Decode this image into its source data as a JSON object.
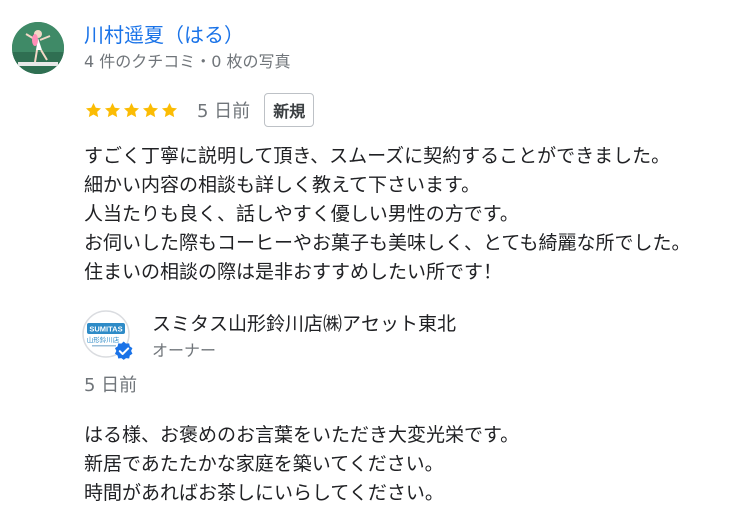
{
  "review": {
    "reviewer_name": "川村遥夏（はる）",
    "reviewer_meta": "4 件のクチコミ・0 枚の写真",
    "rating": 5,
    "rating_max": 5,
    "star_color": "#fbbc04",
    "date": "5 日前",
    "badge": "新規",
    "text_lines": [
      "すごく丁寧に説明して頂き、スムーズに契約することができました。",
      "細かい内容の相談も詳しく教えて下さいます。",
      "人当たりも良く、話しやすく優しい男性の方です。",
      "お伺いした際もコーヒーやお菓子も美味しく、とても綺麗な所でした。",
      "住まいの相談の際は是非おすすめしたい所です！"
    ]
  },
  "owner_reply": {
    "owner_name": "スミタス山形鈴川店㈱アセット東北",
    "role": "オーナー",
    "logo_text": "SUMITAS",
    "logo_subtext": "山形鈴川店",
    "verified_icon": "verified-check-icon",
    "date": "5 日前",
    "text_lines": [
      "はる様、お褒めのお言葉をいただき大変光栄です。",
      "新居であたたかな家庭を築いてください。",
      "時間があればお茶しにいらしてください。"
    ]
  },
  "colors": {
    "link": "#1a73e8",
    "secondary_text": "#70757a",
    "accent_blue": "#1a73e8",
    "logo_blue": "#2e8bc7"
  }
}
